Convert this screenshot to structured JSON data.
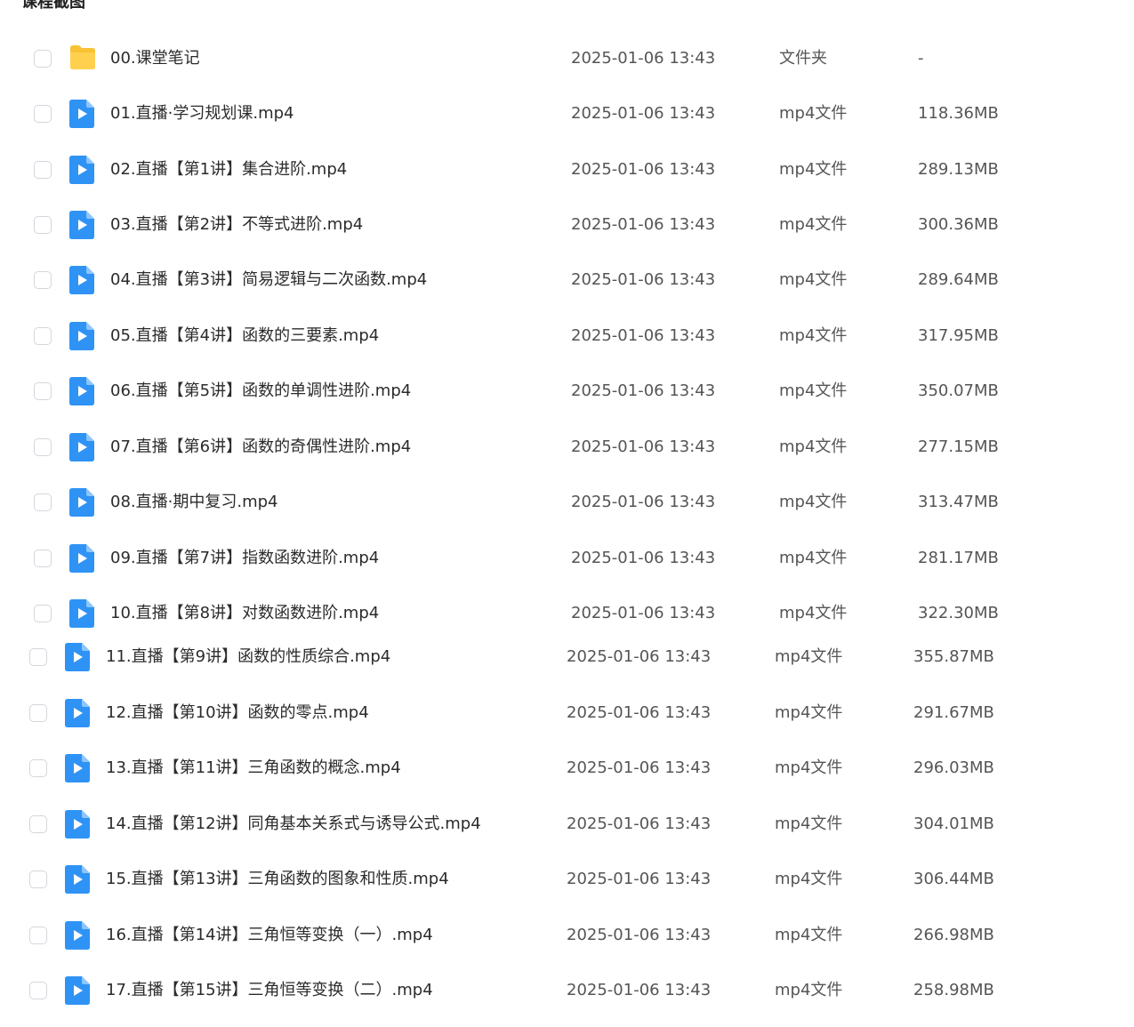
{
  "section_title": "课程截图",
  "files": [
    {
      "name": "00.课堂笔记",
      "date": "2025-01-06 13:43",
      "type": "文件夹",
      "size": "-",
      "icon": "folder-icon"
    },
    {
      "name": "01.直播·学习规划课.mp4",
      "date": "2025-01-06 13:43",
      "type": "mp4文件",
      "size": "118.36MB",
      "icon": "video-icon"
    },
    {
      "name": "02.直播【第1讲】集合进阶.mp4",
      "date": "2025-01-06 13:43",
      "type": "mp4文件",
      "size": "289.13MB",
      "icon": "video-icon"
    },
    {
      "name": "03.直播【第2讲】不等式进阶.mp4",
      "date": "2025-01-06 13:43",
      "type": "mp4文件",
      "size": "300.36MB",
      "icon": "video-icon"
    },
    {
      "name": "04.直播【第3讲】简易逻辑与二次函数.mp4",
      "date": "2025-01-06 13:43",
      "type": "mp4文件",
      "size": "289.64MB",
      "icon": "video-icon"
    },
    {
      "name": "05.直播【第4讲】函数的三要素.mp4",
      "date": "2025-01-06 13:43",
      "type": "mp4文件",
      "size": "317.95MB",
      "icon": "video-icon"
    },
    {
      "name": "06.直播【第5讲】函数的单调性进阶.mp4",
      "date": "2025-01-06 13:43",
      "type": "mp4文件",
      "size": "350.07MB",
      "icon": "video-icon"
    },
    {
      "name": "07.直播【第6讲】函数的奇偶性进阶.mp4",
      "date": "2025-01-06 13:43",
      "type": "mp4文件",
      "size": "277.15MB",
      "icon": "video-icon"
    },
    {
      "name": "08.直播·期中复习.mp4",
      "date": "2025-01-06 13:43",
      "type": "mp4文件",
      "size": "313.47MB",
      "icon": "video-icon"
    },
    {
      "name": "09.直播【第7讲】指数函数进阶.mp4",
      "date": "2025-01-06 13:43",
      "type": "mp4文件",
      "size": "281.17MB",
      "icon": "video-icon"
    },
    {
      "name": "10.直播【第8讲】对数函数进阶.mp4",
      "date": "2025-01-06 13:43",
      "type": "mp4文件",
      "size": "322.30MB",
      "icon": "video-icon"
    },
    {
      "name": "11.直播【第9讲】函数的性质综合.mp4",
      "date": "2025-01-06 13:43",
      "type": "mp4文件",
      "size": "355.87MB",
      "icon": "video-icon"
    },
    {
      "name": "12.直播【第10讲】函数的零点.mp4",
      "date": "2025-01-06 13:43",
      "type": "mp4文件",
      "size": "291.67MB",
      "icon": "video-icon"
    },
    {
      "name": "13.直播【第11讲】三角函数的概念.mp4",
      "date": "2025-01-06 13:43",
      "type": "mp4文件",
      "size": "296.03MB",
      "icon": "video-icon"
    },
    {
      "name": "14.直播【第12讲】同角基本关系式与诱导公式.mp4",
      "date": "2025-01-06 13:43",
      "type": "mp4文件",
      "size": "304.01MB",
      "icon": "video-icon"
    },
    {
      "name": "15.直播【第13讲】三角函数的图象和性质.mp4",
      "date": "2025-01-06 13:43",
      "type": "mp4文件",
      "size": "306.44MB",
      "icon": "video-icon"
    },
    {
      "name": "16.直播【第14讲】三角恒等变换（一）.mp4",
      "date": "2025-01-06 13:43",
      "type": "mp4文件",
      "size": "266.98MB",
      "icon": "video-icon"
    },
    {
      "name": "17.直播【第15讲】三角恒等变换（二）.mp4",
      "date": "2025-01-06 13:43",
      "type": "mp4文件",
      "size": "258.98MB",
      "icon": "video-icon"
    }
  ],
  "colors": {
    "folder": "#f7c233",
    "video": "#2f93f5",
    "checkbox_border": "#d3d6dc"
  }
}
